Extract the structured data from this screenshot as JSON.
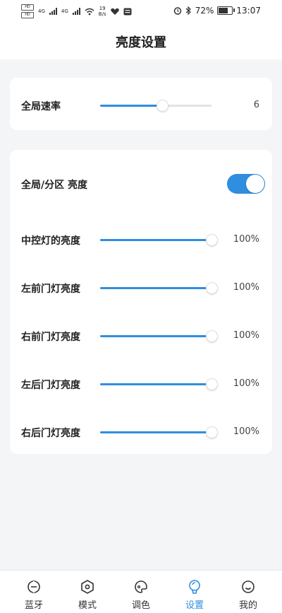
{
  "status_bar": {
    "sim1": "HD",
    "sim2": "HD",
    "net1": "4G",
    "net2": "4G",
    "speed_value": "19",
    "speed_unit": "B/s",
    "battery": "72%",
    "time": "13:07",
    "icons": [
      "alarm-icon",
      "bluetooth-icon",
      "battery-icon",
      "wifi-icon",
      "heart-icon",
      "message-icon"
    ]
  },
  "header": {
    "title": "亮度设置"
  },
  "card1": {
    "rate": {
      "label": "全局速率",
      "value": "6",
      "level": 0.56
    }
  },
  "card2": {
    "toggle": {
      "label": "全局/分区 亮度",
      "on": true
    },
    "sliders": [
      {
        "label": "中控灯的亮度",
        "value": "100%",
        "level": 1.0
      },
      {
        "label": "左前门灯亮度",
        "value": "100%",
        "level": 1.0
      },
      {
        "label": "右前门灯亮度",
        "value": "100%",
        "level": 1.0
      },
      {
        "label": "左后门灯亮度",
        "value": "100%",
        "level": 1.0
      },
      {
        "label": "右后门灯亮度",
        "value": "100%",
        "level": 1.0
      }
    ]
  },
  "tabbar": {
    "items": [
      {
        "label": "蓝牙",
        "icon": "bluetooth-tab-icon"
      },
      {
        "label": "模式",
        "icon": "hexagon-icon"
      },
      {
        "label": "调色",
        "icon": "palette-icon"
      },
      {
        "label": "设置",
        "icon": "bulb-icon",
        "active": true
      },
      {
        "label": "我的",
        "icon": "smile-icon"
      }
    ]
  },
  "colors": {
    "accent": "#2f8ee0",
    "background": "#f4f5f7",
    "card": "#ffffff"
  }
}
